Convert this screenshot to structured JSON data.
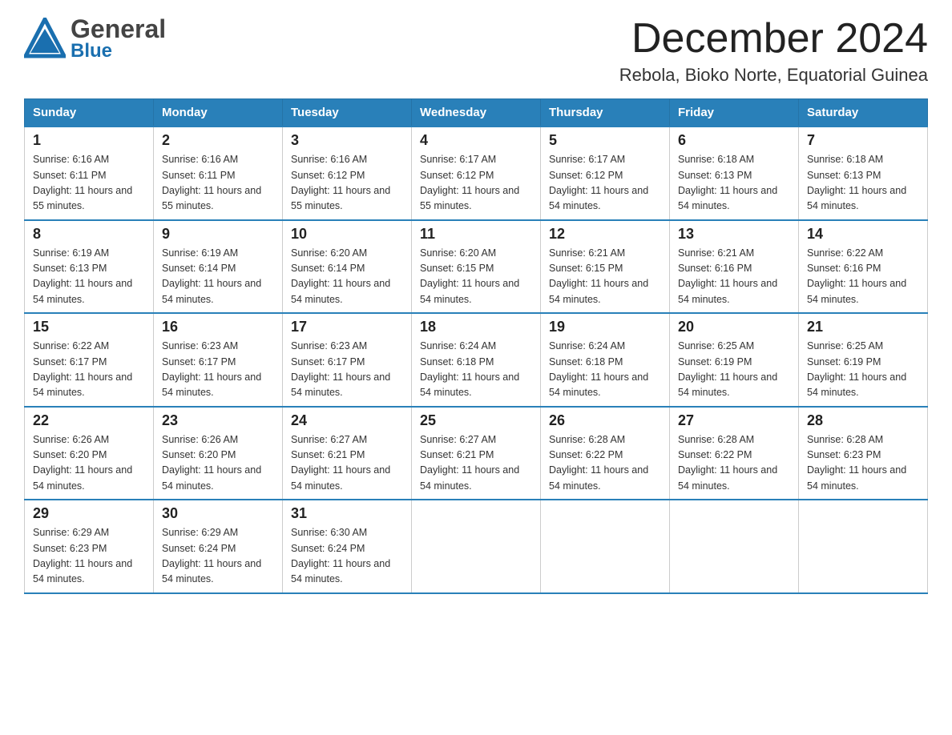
{
  "header": {
    "logo_general": "General",
    "logo_blue": "Blue",
    "title": "December 2024",
    "subtitle": "Rebola, Bioko Norte, Equatorial Guinea"
  },
  "days_of_week": [
    "Sunday",
    "Monday",
    "Tuesday",
    "Wednesday",
    "Thursday",
    "Friday",
    "Saturday"
  ],
  "weeks": [
    [
      {
        "day": "1",
        "sunrise": "6:16 AM",
        "sunset": "6:11 PM",
        "daylight": "11 hours and 55 minutes."
      },
      {
        "day": "2",
        "sunrise": "6:16 AM",
        "sunset": "6:11 PM",
        "daylight": "11 hours and 55 minutes."
      },
      {
        "day": "3",
        "sunrise": "6:16 AM",
        "sunset": "6:12 PM",
        "daylight": "11 hours and 55 minutes."
      },
      {
        "day": "4",
        "sunrise": "6:17 AM",
        "sunset": "6:12 PM",
        "daylight": "11 hours and 55 minutes."
      },
      {
        "day": "5",
        "sunrise": "6:17 AM",
        "sunset": "6:12 PM",
        "daylight": "11 hours and 54 minutes."
      },
      {
        "day": "6",
        "sunrise": "6:18 AM",
        "sunset": "6:13 PM",
        "daylight": "11 hours and 54 minutes."
      },
      {
        "day": "7",
        "sunrise": "6:18 AM",
        "sunset": "6:13 PM",
        "daylight": "11 hours and 54 minutes."
      }
    ],
    [
      {
        "day": "8",
        "sunrise": "6:19 AM",
        "sunset": "6:13 PM",
        "daylight": "11 hours and 54 minutes."
      },
      {
        "day": "9",
        "sunrise": "6:19 AM",
        "sunset": "6:14 PM",
        "daylight": "11 hours and 54 minutes."
      },
      {
        "day": "10",
        "sunrise": "6:20 AM",
        "sunset": "6:14 PM",
        "daylight": "11 hours and 54 minutes."
      },
      {
        "day": "11",
        "sunrise": "6:20 AM",
        "sunset": "6:15 PM",
        "daylight": "11 hours and 54 minutes."
      },
      {
        "day": "12",
        "sunrise": "6:21 AM",
        "sunset": "6:15 PM",
        "daylight": "11 hours and 54 minutes."
      },
      {
        "day": "13",
        "sunrise": "6:21 AM",
        "sunset": "6:16 PM",
        "daylight": "11 hours and 54 minutes."
      },
      {
        "day": "14",
        "sunrise": "6:22 AM",
        "sunset": "6:16 PM",
        "daylight": "11 hours and 54 minutes."
      }
    ],
    [
      {
        "day": "15",
        "sunrise": "6:22 AM",
        "sunset": "6:17 PM",
        "daylight": "11 hours and 54 minutes."
      },
      {
        "day": "16",
        "sunrise": "6:23 AM",
        "sunset": "6:17 PM",
        "daylight": "11 hours and 54 minutes."
      },
      {
        "day": "17",
        "sunrise": "6:23 AM",
        "sunset": "6:17 PM",
        "daylight": "11 hours and 54 minutes."
      },
      {
        "day": "18",
        "sunrise": "6:24 AM",
        "sunset": "6:18 PM",
        "daylight": "11 hours and 54 minutes."
      },
      {
        "day": "19",
        "sunrise": "6:24 AM",
        "sunset": "6:18 PM",
        "daylight": "11 hours and 54 minutes."
      },
      {
        "day": "20",
        "sunrise": "6:25 AM",
        "sunset": "6:19 PM",
        "daylight": "11 hours and 54 minutes."
      },
      {
        "day": "21",
        "sunrise": "6:25 AM",
        "sunset": "6:19 PM",
        "daylight": "11 hours and 54 minutes."
      }
    ],
    [
      {
        "day": "22",
        "sunrise": "6:26 AM",
        "sunset": "6:20 PM",
        "daylight": "11 hours and 54 minutes."
      },
      {
        "day": "23",
        "sunrise": "6:26 AM",
        "sunset": "6:20 PM",
        "daylight": "11 hours and 54 minutes."
      },
      {
        "day": "24",
        "sunrise": "6:27 AM",
        "sunset": "6:21 PM",
        "daylight": "11 hours and 54 minutes."
      },
      {
        "day": "25",
        "sunrise": "6:27 AM",
        "sunset": "6:21 PM",
        "daylight": "11 hours and 54 minutes."
      },
      {
        "day": "26",
        "sunrise": "6:28 AM",
        "sunset": "6:22 PM",
        "daylight": "11 hours and 54 minutes."
      },
      {
        "day": "27",
        "sunrise": "6:28 AM",
        "sunset": "6:22 PM",
        "daylight": "11 hours and 54 minutes."
      },
      {
        "day": "28",
        "sunrise": "6:28 AM",
        "sunset": "6:23 PM",
        "daylight": "11 hours and 54 minutes."
      }
    ],
    [
      {
        "day": "29",
        "sunrise": "6:29 AM",
        "sunset": "6:23 PM",
        "daylight": "11 hours and 54 minutes."
      },
      {
        "day": "30",
        "sunrise": "6:29 AM",
        "sunset": "6:24 PM",
        "daylight": "11 hours and 54 minutes."
      },
      {
        "day": "31",
        "sunrise": "6:30 AM",
        "sunset": "6:24 PM",
        "daylight": "11 hours and 54 minutes."
      },
      null,
      null,
      null,
      null
    ]
  ]
}
